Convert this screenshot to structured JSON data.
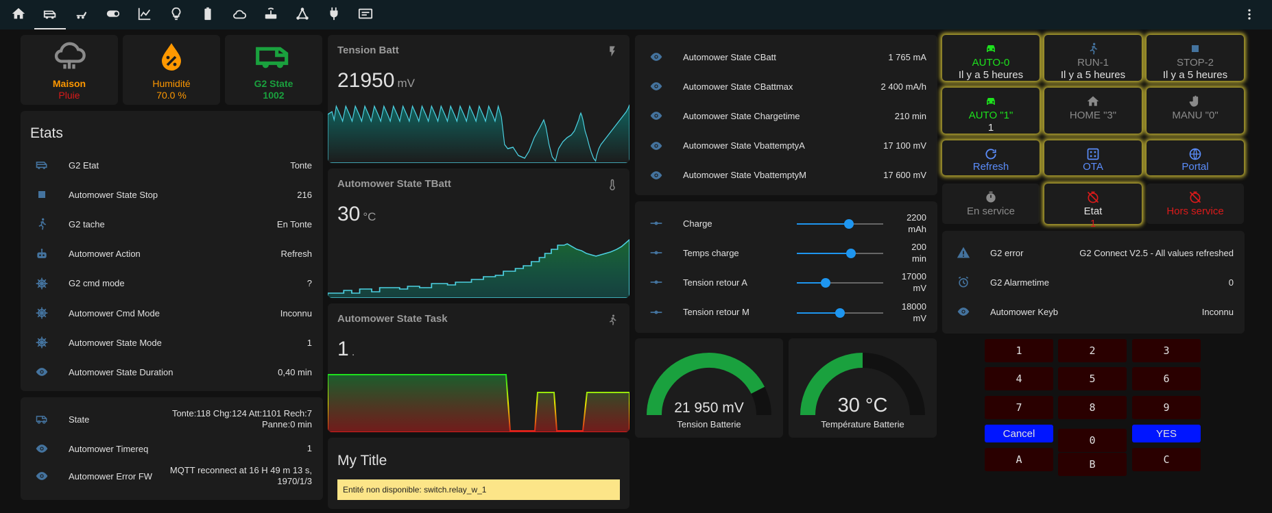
{
  "nav": {
    "icons": [
      "home-icon",
      "rv-icon",
      "mower-icon",
      "toggle-icon",
      "chart-line-icon",
      "lightbulb-icon",
      "battery-icon",
      "cloud-icon",
      "router-icon",
      "network-icon",
      "plug-icon",
      "display-icon"
    ],
    "menu_icon": "dots-vertical-icon"
  },
  "tiles": [
    {
      "name": "Maison",
      "state": "Pluie",
      "name_color": "#ff9800",
      "state_color": "#db1a1a",
      "icon": "cloud-rain-icon"
    },
    {
      "name": "Humidité",
      "state": "70.0 %",
      "name_color": "#ff9800",
      "state_color": "#ff9800",
      "icon": "water-percent-icon"
    },
    {
      "name": "G2 State",
      "state": "1002",
      "name_color": "#1aa13e",
      "state_color": "#1aa13e",
      "icon": "rv-truck-icon"
    }
  ],
  "etats": {
    "title": "Etats",
    "rows": [
      {
        "icon": "rv-icon",
        "name": "G2 Etat",
        "value": "Tonte"
      },
      {
        "icon": "stop-icon",
        "name": "Automower State Stop",
        "value": "216"
      },
      {
        "icon": "run-icon",
        "name": "G2 tache",
        "value": "En Tonte"
      },
      {
        "icon": "robot-icon",
        "name": "Automower Action",
        "value": "Refresh"
      },
      {
        "icon": "ship-wheel-icon",
        "name": "G2 cmd mode",
        "value": "?"
      },
      {
        "icon": "ship-wheel-icon",
        "name": "Automower Cmd Mode",
        "value": "Inconnu"
      },
      {
        "icon": "ship-wheel-icon",
        "name": "Automower State Mode",
        "value": "1"
      },
      {
        "icon": "eye-icon",
        "name": "Automower State Duration",
        "value": "0,40 min"
      }
    ]
  },
  "state_card": {
    "rows": [
      {
        "icon": "rv-outline-icon",
        "name": "State",
        "value1": "Tonte:118 Chg:124 Att:1101 Rech:7",
        "value2": "Panne:0 min"
      },
      {
        "icon": "eye-icon",
        "name": "Automower Timereq",
        "value1": "1",
        "value2": ""
      },
      {
        "icon": "eye-icon",
        "name": "Automower Error FW",
        "value1": "MQTT reconnect at 16 H 49 m 13 s,",
        "value2": "1970/1/3"
      }
    ]
  },
  "sensors": [
    {
      "title": "Tension Batt",
      "value": "21950",
      "unit": "mV",
      "icon": "flash-icon"
    },
    {
      "title": "Automower State TBatt",
      "value": "30",
      "unit": "°C",
      "icon": "thermometer-icon"
    },
    {
      "title": "Automower State Task",
      "value": "1",
      "unit": ".",
      "icon": "run-icon"
    }
  ],
  "mytitle": {
    "title": "My Title",
    "warning": "Entité non disponible: switch.relay_w_1"
  },
  "cbatt": {
    "rows": [
      {
        "name": "Automower State CBatt",
        "value": "1 765 mA"
      },
      {
        "name": "Automower State CBattmax",
        "value": "2 400 mA/h"
      },
      {
        "name": "Automower State Chargetime",
        "value": "210 min"
      },
      {
        "name": "Automower State VbattemptyA",
        "value": "17 100 mV"
      },
      {
        "name": "Automower State VbattemptyM",
        "value": "17 600 mV"
      }
    ]
  },
  "sliders": [
    {
      "name": "Charge",
      "value": "2200",
      "unit": "mAh",
      "level": 0.6
    },
    {
      "name": "Temps charge",
      "value": "200",
      "unit": "min",
      "level": 0.63
    },
    {
      "name": "Tension retour A",
      "value": "17000",
      "unit": "mV",
      "level": 0.33
    },
    {
      "name": "Tension retour M",
      "value": "18000",
      "unit": "mV",
      "level": 0.5
    }
  ],
  "gauges": [
    {
      "value": "21 950 mV",
      "label": "Tension Batterie",
      "level": 0.85
    },
    {
      "value": "30 °C",
      "label": "Température Batterie",
      "level": 0.5
    }
  ],
  "buttons": [
    {
      "icon": "car-icon",
      "line1": "AUTO-0",
      "line2": "Il y a 5 heures",
      "color1": "#1de21d",
      "color2": "#e1e1e1",
      "glow": true
    },
    {
      "icon": "run-icon",
      "line1": "RUN-1",
      "line2": "Il y a 5 heures",
      "color1": "#8a8a8a",
      "color2": "#e1e1e1",
      "glow": true
    },
    {
      "icon": "stop-icon",
      "line1": "STOP-2",
      "line2": "Il y a 5 heures",
      "color1": "#8a8a8a",
      "color2": "#e1e1e1",
      "glow": true
    },
    {
      "icon": "car-icon",
      "line1": "AUTO \"1\"",
      "line2": "1",
      "color1": "#1de21d",
      "color2": "#e1e1e1",
      "glow": true
    },
    {
      "icon": "home-icon",
      "line1": "HOME \"3\"",
      "line2": "",
      "color1": "#8a8a8a",
      "color2": "#e1e1e1",
      "glow": true
    },
    {
      "icon": "hand-icon",
      "line1": "MANU \"0\"",
      "line2": "",
      "color1": "#8a8a8a",
      "color2": "#e1e1e1",
      "glow": true
    },
    {
      "icon": "refresh-icon",
      "line1": "Refresh",
      "line2": "",
      "color1": "#5b8dfb",
      "color2": "#e1e1e1",
      "glow": true
    },
    {
      "icon": "grid-icon",
      "line1": "OTA",
      "line2": "",
      "color1": "#5b8dfb",
      "color2": "#e1e1e1",
      "glow": true
    },
    {
      "icon": "globe-icon",
      "line1": "Portal",
      "line2": "",
      "color1": "#5b8dfb",
      "color2": "#e1e1e1",
      "glow": true
    },
    {
      "icon": "timer-icon",
      "line1": "En service",
      "line2": "",
      "color1": "#8a8a8a",
      "color2": "#e1e1e1",
      "glow": false
    },
    {
      "icon": "timer-off-icon",
      "line1": "Etat",
      "line2": "1",
      "color1": "#e1e1e1",
      "color2": "#db1a1a",
      "glow": true
    },
    {
      "icon": "timer-off-icon",
      "line1": "Hors service",
      "line2": "",
      "color1": "#db1a1a",
      "color2": "#e1e1e1",
      "glow": false
    }
  ],
  "errors": {
    "rows": [
      {
        "icon": "alert-icon",
        "name": "G2 error",
        "value": "G2 Connect V2.5 - All values refreshed"
      },
      {
        "icon": "alarm-clock-icon",
        "name": "G2 Alarmetime",
        "value": "0"
      },
      {
        "icon": "eye-icon",
        "name": "Automower Keyb",
        "value": "Inconnu"
      }
    ]
  },
  "keypad": {
    "keys": [
      "1",
      "2",
      "3",
      "4",
      "5",
      "6",
      "7",
      "8",
      "9",
      "Cancel",
      "0",
      "YES",
      "A",
      "B",
      "C"
    ]
  }
}
